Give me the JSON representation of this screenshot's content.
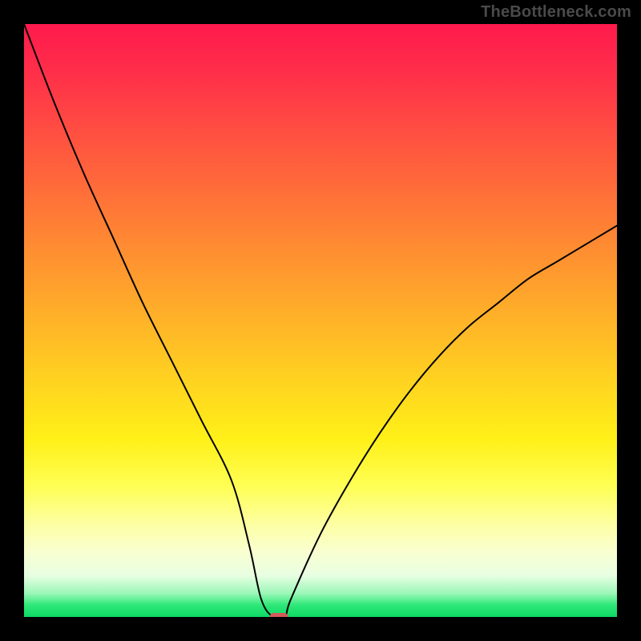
{
  "watermark": "TheBottleneck.com",
  "colors": {
    "curve_stroke": "#000000",
    "marker_fill": "#d25a5a",
    "frame_bg": "#000000",
    "gradient_top": "#ff1a4d",
    "gradient_bottom": "#0ed765"
  },
  "chart_data": {
    "type": "line",
    "title": "",
    "xlabel": "",
    "ylabel": "",
    "ylim": [
      0,
      100
    ],
    "x": [
      0,
      5,
      10,
      15,
      20,
      25,
      30,
      35,
      38,
      40,
      42,
      44,
      45,
      50,
      55,
      60,
      65,
      70,
      75,
      80,
      85,
      90,
      95,
      100
    ],
    "values": [
      100,
      87,
      75,
      64,
      53,
      43,
      33,
      23,
      12,
      3,
      0,
      0,
      3,
      14,
      23,
      31,
      38,
      44,
      49,
      53,
      57,
      60,
      63,
      66
    ],
    "optimal_x": 43,
    "optimal_y": 0,
    "marker": {
      "x": 43,
      "y": 0,
      "w": 3,
      "h": 1.2
    }
  }
}
